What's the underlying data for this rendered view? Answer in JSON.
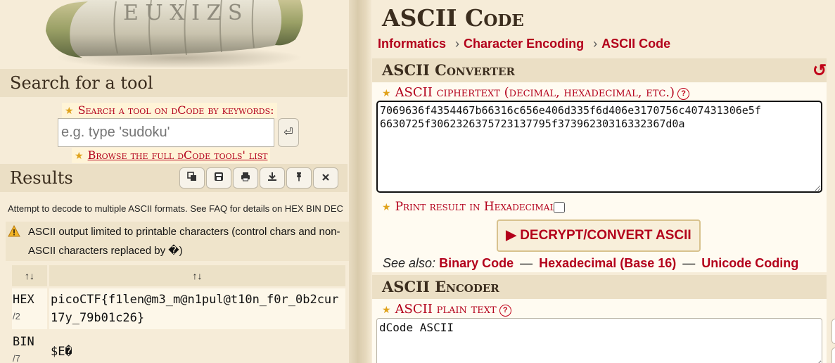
{
  "left": {
    "logo_letters": "E U X I Z S",
    "search_section_title": "Search for a tool",
    "search_keywords_label": "Search a tool on dCode by keywords:",
    "search_placeholder": "e.g. type 'sudoku'",
    "search_go_glyph": "⏎",
    "browse_link": "Browse the full dCode tools' list",
    "results_title": "Results",
    "toolbar_icons": [
      "copy-icon",
      "save-icon",
      "print-icon",
      "download-icon",
      "pin-icon",
      "close-icon"
    ],
    "notice": "Attempt to decode to multiple ASCII formats. See FAQ for details on HEX BIN DEC",
    "warning": "ASCII output limited to printable characters (control chars and non-ASCII characters replaced by �)",
    "table": {
      "header_col1": "↑↓",
      "header_col2": "↑↓",
      "rows": [
        {
          "label": "HEX",
          "sub": "/2",
          "value": "picoCTF{f1len@m3_m@n1pul@t10n_f0r_0b2cur17y_79b01c26}"
        },
        {
          "label": "BIN",
          "sub": "/7",
          "value": "$E�"
        }
      ]
    }
  },
  "right": {
    "page_title": "ASCII Code",
    "breadcrumb": [
      "Informatics",
      "Character Encoding",
      "ASCII Code"
    ],
    "breadcrumb_sep": "›",
    "reset_glyph": "↺",
    "converter": {
      "title": "ASCII Converter",
      "ciphertext_label": "ASCII ciphertext (decimal, hexadecimal, etc.)",
      "help_glyph": "?",
      "ciphertext_value": "7069636f4354467b66316c656e406d335f6d406e3170756c407431306e5f\n6630725f3062326375723137795f37396230316332367d0a",
      "print_hex_label": "Print result in Hexadecimal",
      "print_hex_checked": false,
      "decrypt_button": "▶ DECRYPT/CONVERT ASCII",
      "see_also_label": "See also:",
      "see_also_links": [
        "Binary Code",
        "Hexadecimal (Base 16)",
        "Unicode Coding"
      ],
      "see_also_sep": "—"
    },
    "encoder": {
      "title": "ASCII Encoder",
      "plaintext_label": "ASCII plain text",
      "help_glyph": "?",
      "plaintext_value": "dCode ASCII"
    }
  },
  "colors": {
    "link_red": "#b3001b",
    "star_gold": "#e0a21a",
    "bar_beige": "#ebdfc5",
    "page_bg": "#f6ecd8",
    "heading_brown": "#3b2d1e"
  }
}
